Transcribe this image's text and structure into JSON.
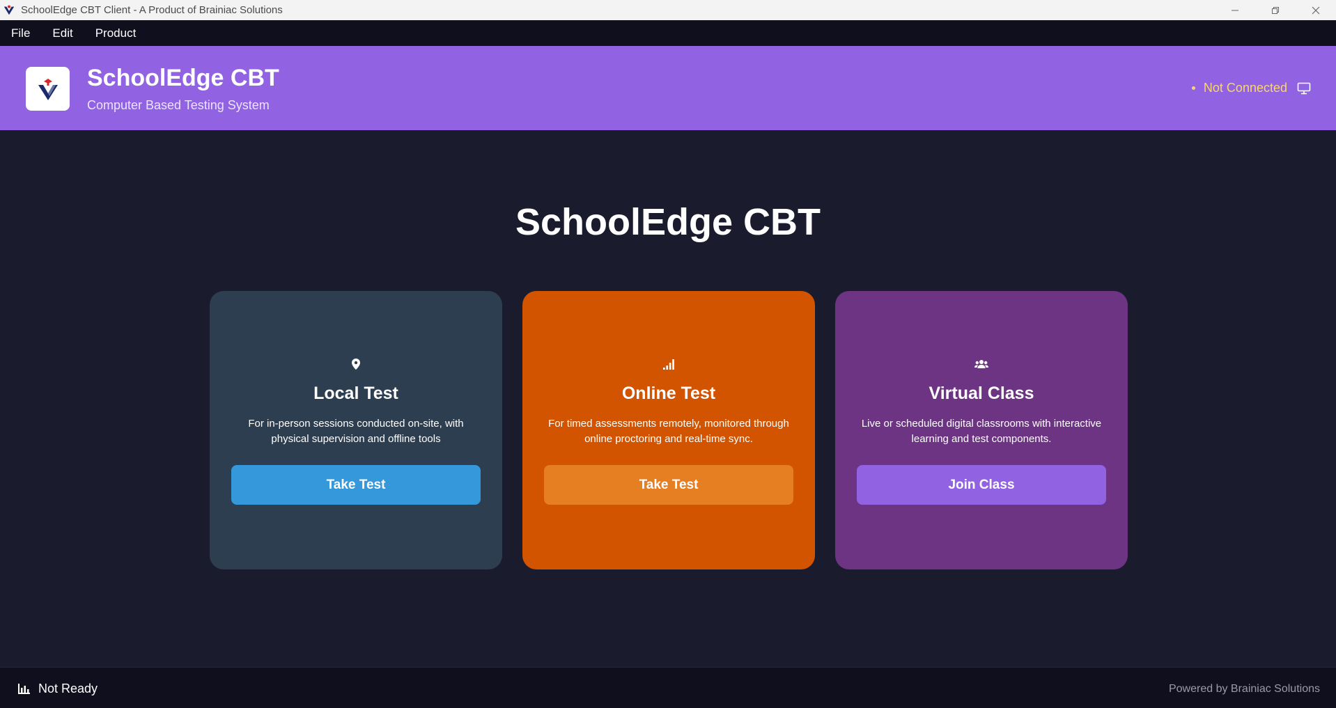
{
  "window": {
    "title": "SchoolEdge CBT Client - A Product of Brainiac Solutions"
  },
  "menu": {
    "items": [
      "File",
      "Edit",
      "Product"
    ]
  },
  "header": {
    "title": "SchoolEdge CBT",
    "subtitle": "Computer Based Testing System",
    "connection_status": "Not Connected",
    "status_color": "#f9d66c"
  },
  "main": {
    "title": "SchoolEdge CBT",
    "cards": [
      {
        "icon": "map-pin-icon",
        "title": "Local Test",
        "description": "For in-person sessions conducted on-site, with physical supervision and offline tools",
        "button": "Take Test",
        "color": "#2d3e50",
        "button_color": "#3598db"
      },
      {
        "icon": "signal-bars-icon",
        "title": "Online Test",
        "description": "For timed assessments remotely, monitored through online proctoring and real-time sync.",
        "button": "Take Test",
        "color": "#d35400",
        "button_color": "#e67e22"
      },
      {
        "icon": "users-icon",
        "title": "Virtual Class",
        "description": "Live or scheduled digital classrooms with interactive learning and test components.",
        "button": "Join Class",
        "color": "#6c3483",
        "button_color": "#9162e2"
      }
    ]
  },
  "statusbar": {
    "status": "Not Ready",
    "powered_by": "Powered by Brainiac Solutions"
  }
}
